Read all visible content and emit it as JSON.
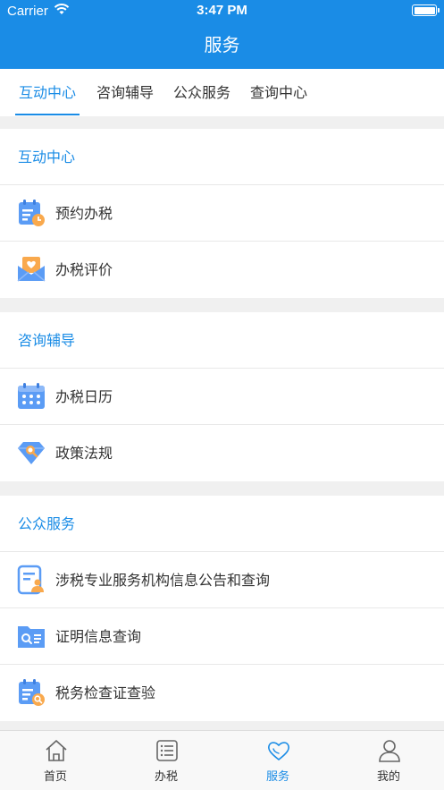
{
  "status_bar": {
    "carrier": "Carrier",
    "time": "3:47 PM"
  },
  "nav": {
    "title": "服务"
  },
  "tabs": [
    {
      "label": "互动中心",
      "active": true
    },
    {
      "label": "咨询辅导",
      "active": false
    },
    {
      "label": "公众服务",
      "active": false
    },
    {
      "label": "查询中心",
      "active": false
    }
  ],
  "sections": [
    {
      "title": "互动中心",
      "items": [
        {
          "label": "预约办税",
          "icon": "calendar-clock-icon"
        },
        {
          "label": "办税评价",
          "icon": "heart-envelope-icon"
        }
      ]
    },
    {
      "title": "咨询辅导",
      "items": [
        {
          "label": "办税日历",
          "icon": "calendar-grid-icon"
        },
        {
          "label": "政策法规",
          "icon": "diamond-search-icon"
        }
      ]
    },
    {
      "title": "公众服务",
      "items": [
        {
          "label": "涉税专业服务机构信息公告和查询",
          "icon": "document-person-icon"
        },
        {
          "label": "证明信息查询",
          "icon": "folder-search-icon"
        },
        {
          "label": "税务检查证查验",
          "icon": "calendar-search-icon"
        }
      ]
    }
  ],
  "bottom_tabs": [
    {
      "label": "首页",
      "icon": "home-icon",
      "active": false
    },
    {
      "label": "办税",
      "icon": "list-icon",
      "active": false
    },
    {
      "label": "服务",
      "icon": "heart-icon",
      "active": true
    },
    {
      "label": "我的",
      "icon": "person-icon",
      "active": false
    }
  ],
  "colors": {
    "accent": "#1a8ce6",
    "background": "#f0f0f0"
  }
}
